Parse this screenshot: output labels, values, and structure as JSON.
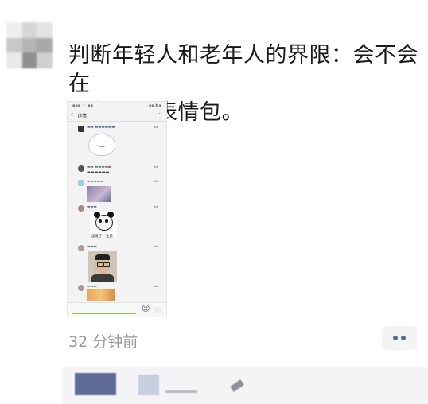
{
  "post": {
    "text_line1": "判断年轻人和老年人的界限：会不会在",
    "text_line2": "朋友圈玩表情包。",
    "timestamp": "32 分钟前"
  },
  "colors": {
    "link_blue": "#576b95",
    "text_gray": "#999999",
    "background": "#ffffff"
  },
  "icons": {
    "more": "two-dot-ellipsis",
    "emoji": "smiley"
  },
  "embedded_screenshot": {
    "nav_title": "详情",
    "caption_text": "加发了，注意"
  }
}
